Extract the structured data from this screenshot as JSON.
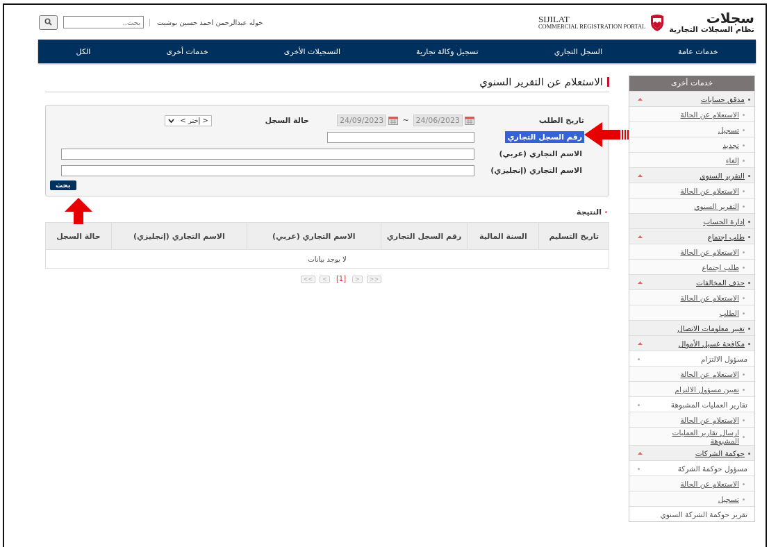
{
  "header": {
    "logo": {
      "arabic_title": "سجلات",
      "arabic_subtitle": "نظام السجلات التجارية",
      "english_title": "SIJILAT",
      "english_subtitle": "COMMERCIAL REGISTRATION PORTAL"
    },
    "user_name": "خوله عبدالرحمن احمد حسين بوشيت",
    "search": {
      "placeholder": "بحث.."
    }
  },
  "nav": [
    "خدمات عامة",
    "السجل التجاري",
    "تسجيل وكالة تجارية",
    "التسجيلات الأخرى",
    "خدمات أخرى",
    "الكل"
  ],
  "page_title": "الاستعلام عن التقرير السنوي",
  "form": {
    "request_date": {
      "label": "تاريخ الطلب",
      "from": "24/06/2023",
      "separator": "~",
      "to": "24/09/2023"
    },
    "record_status": {
      "label": "حالة السجل",
      "value": "< إختر >"
    },
    "fields": [
      {
        "label": "رقم السجل التجاري",
        "kind": "number",
        "highlighted": true
      },
      {
        "label": "الاسم التجاري (عربي)",
        "kind": "text",
        "highlighted": false
      },
      {
        "label": "الاسم التجاري (إنجليزي)",
        "kind": "text",
        "highlighted": false
      }
    ],
    "search_button": "بحث"
  },
  "results": {
    "title": "النتيجة",
    "columns": [
      "تاريخ التسليم",
      "السنة المالية",
      "رقم السجل التجاري",
      "الاسم التجاري (عربي)",
      "الاسم التجاري (إنجليزي)",
      "حالة السجل"
    ],
    "empty_message": "لا يوجد بيانات",
    "pagination": [
      {
        "label": ">>",
        "selected": false
      },
      {
        "label": ">",
        "selected": false
      },
      {
        "label": "[1]",
        "selected": true
      },
      {
        "label": "<",
        "selected": false
      },
      {
        "label": "<<",
        "selected": false
      }
    ]
  },
  "sidebar": {
    "title": "خدمات أخرى",
    "items": [
      {
        "label": "مدقق حسابات",
        "expanded": true,
        "children": [
          {
            "kind": "link",
            "label": "الاستعلام عن الحالة"
          },
          {
            "kind": "link",
            "label": "تسجيل"
          },
          {
            "kind": "link",
            "label": "تجديد"
          },
          {
            "kind": "link",
            "label": "إلغاء"
          }
        ]
      },
      {
        "label": "التقرير السنوي",
        "expanded": true,
        "children": [
          {
            "kind": "link",
            "label": "الاستعلام عن الحالة"
          },
          {
            "kind": "link",
            "label": "التقرير السنوي"
          }
        ]
      },
      {
        "label": "إدارة الحساب",
        "expanded": false
      },
      {
        "label": "طلب اجتماع",
        "expanded": true,
        "children": [
          {
            "kind": "link",
            "label": "الاستعلام عن الحالة"
          },
          {
            "kind": "link",
            "label": "طلب اجتماع"
          }
        ]
      },
      {
        "label": "حذف المخالفات",
        "expanded": true,
        "children": [
          {
            "kind": "link",
            "label": "الاستعلام عن الحالة"
          },
          {
            "kind": "link",
            "label": "الطلب"
          }
        ]
      },
      {
        "label": "تغيير معلومات الاتصال",
        "expanded": false
      },
      {
        "label": "مكافحة غسيل الأموال",
        "expanded": true,
        "children": [
          {
            "kind": "group",
            "label": "مسؤول الالتزام",
            "children": [
              {
                "kind": "link",
                "label": "الاستعلام عن الحالة"
              },
              {
                "kind": "link",
                "label": "تعيين مسؤول الالتزام"
              }
            ]
          },
          {
            "kind": "group",
            "label": "تقارير العمليات المشبوهة",
            "children": [
              {
                "kind": "link",
                "label": "الاستعلام عن الحالة"
              },
              {
                "kind": "link",
                "label": "ارسال تقارير العمليات المشبوهة"
              }
            ]
          }
        ]
      },
      {
        "label": "حوكمة الشركات",
        "expanded": true,
        "children": [
          {
            "kind": "group",
            "label": "مسؤول حوكمة الشركة",
            "children": [
              {
                "kind": "link",
                "label": "الاستعلام عن الحالة"
              },
              {
                "kind": "link",
                "label": "تسجيل"
              }
            ]
          },
          {
            "kind": "plain",
            "label": "تقرير حوكمة الشركة السنوي"
          }
        ]
      }
    ]
  }
}
